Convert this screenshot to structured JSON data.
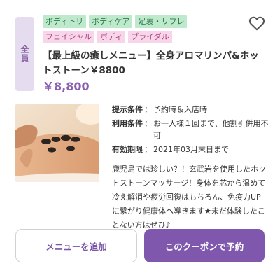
{
  "badge": {
    "label": "全員"
  },
  "tags": {
    "row1": [
      "ボディトリ",
      "ボディケア",
      "足裏・リフレ"
    ],
    "row2": [
      "フェイシャル",
      "ボディ",
      "ブライダル"
    ]
  },
  "favorite": {
    "icon": "heart-outline-icon"
  },
  "title": "【最上級の癒しメニュー】全身アロマリンパ&ホットストーン￥8800",
  "price": "￥8,800",
  "photo": {
    "icon": "hot-stone-massage-photo"
  },
  "conditions": [
    {
      "label": "提示条件",
      "value": "予約時＆入店時"
    },
    {
      "label": "利用条件",
      "value": "お一人様１回まで、他割引併用不可"
    },
    {
      "label": "有効期限",
      "value": "2021年03月末日まで"
    }
  ],
  "separator": "：",
  "description": "鹿児島では珍しい？！玄武岩を使用したホットストーンマッサージ！身体を芯から温めて冷え解消や疲労回復はもちろん、免疫力UPに繋がり健康体へ導きます★未だ体験したことない方はぜひ♪",
  "buttons": {
    "add_menu": "メニューを追加",
    "reserve": "このクーポンで予約"
  },
  "colors": {
    "accent": "#7f58ae",
    "price": "#8a5fb0",
    "badge_bg": "#e6dcef",
    "tag_green_bg": "#bfe9cd",
    "tag_pink_bg": "#f7d6ea"
  }
}
